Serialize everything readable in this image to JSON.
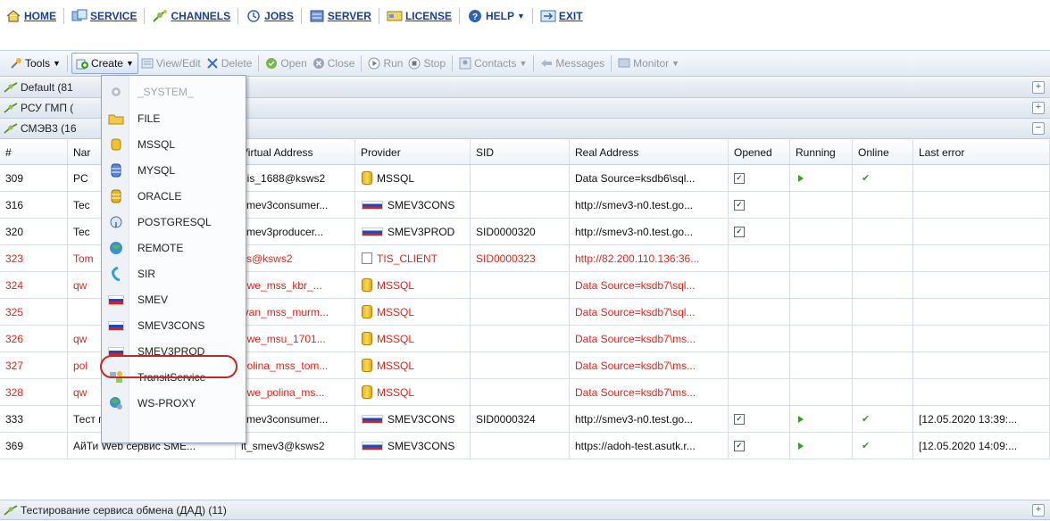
{
  "nav": {
    "home": "HOME",
    "service": "SERVICE",
    "channels": "CHANNELS",
    "jobs": "JOBS",
    "server": "SERVER",
    "license": "LICENSE",
    "help": "HELP",
    "exit": "EXIT"
  },
  "toolbar": {
    "tools": "Tools",
    "create": "Create",
    "view_edit": "View/Edit",
    "delete": "Delete",
    "open": "Open",
    "close": "Close",
    "run": "Run",
    "stop": "Stop",
    "contacts": "Contacts",
    "messages": "Messages",
    "monitor": "Monitor"
  },
  "groups": {
    "default": "Default (81",
    "rsu": "РСУ ГМП (",
    "smev3": "СМЭВ3 (16",
    "test": "Тестирование сервиса обмена (ДАД) (11)"
  },
  "columns": [
    "#",
    "Nar",
    "Virtual Address",
    "Provider",
    "SID",
    "Real Address",
    "Opened",
    "Running",
    "Online",
    "Last error"
  ],
  "rows": [
    {
      "num": "309",
      "name": "PC",
      "vaddr": "gis_1688@ksws2",
      "provider": "MSSQL",
      "picon": "db",
      "sid": "",
      "raddr": "Data Source=ksdb6\\sql...",
      "opened": true,
      "running": true,
      "online": true,
      "error": "",
      "red": false
    },
    {
      "num": "316",
      "name": "Tec",
      "vaddr": "smev3consumer...",
      "provider": "SMEV3CONS",
      "picon": "flag",
      "sid": "",
      "raddr": "http://smev3-n0.test.go...",
      "opened": true,
      "running": false,
      "online": false,
      "error": "",
      "red": false
    },
    {
      "num": "320",
      "name": "Tec",
      "vaddr": "smev3producer...",
      "provider": "SMEV3PROD",
      "picon": "flag",
      "sid": "SID0000320",
      "raddr": "http://smev3-n0.test.go...",
      "opened": true,
      "running": false,
      "online": false,
      "error": "",
      "red": false
    },
    {
      "num": "323",
      "name": "Tom",
      "vaddr": "tis@ksws2",
      "provider": "TIS_CLIENT",
      "picon": "tis",
      "sid": "SID0000323",
      "raddr": "http://82.200.110.136:36...",
      "opened": false,
      "running": false,
      "online": false,
      "error": "",
      "red": true
    },
    {
      "num": "324",
      "name": "qw",
      "vaddr": "qwe_mss_kbr_...",
      "provider": "MSSQL",
      "picon": "db",
      "sid": "",
      "raddr": "Data Source=ksdb7\\sql...",
      "opened": false,
      "running": false,
      "online": false,
      "error": "",
      "red": true
    },
    {
      "num": "325",
      "name": "",
      "vaddr": "ivan_mss_murm...",
      "provider": "MSSQL",
      "picon": "db",
      "sid": "",
      "raddr": "Data Source=ksdb7\\sql...",
      "opened": false,
      "running": false,
      "online": false,
      "error": "",
      "red": true
    },
    {
      "num": "326",
      "name": "qw",
      "vaddr": "qwe_msu_1701...",
      "provider": "MSSQL",
      "picon": "db",
      "sid": "",
      "raddr": "Data Source=ksdb7\\ms...",
      "opened": false,
      "running": false,
      "online": false,
      "error": "",
      "red": true
    },
    {
      "num": "327",
      "name": "pol",
      "vaddr": "polina_mss_tom...",
      "provider": "MSSQL",
      "picon": "db",
      "sid": "",
      "raddr": "Data Source=ksdb7\\ms...",
      "opened": false,
      "running": false,
      "online": false,
      "error": "",
      "red": true
    },
    {
      "num": "328",
      "name": "qw",
      "vaddr": "qwe_polina_ms...",
      "provider": "MSSQL",
      "picon": "db",
      "sid": "",
      "raddr": "Data Source=ksdb7\\ms...",
      "opened": false,
      "running": false,
      "online": false,
      "error": "",
      "red": true
    },
    {
      "num": "333",
      "name": "Тест потребителя СМ...",
      "vaddr": "smev3consumer...",
      "provider": "SMEV3CONS",
      "picon": "flag",
      "sid": "SID0000324",
      "raddr": "http://smev3-n0.test.go...",
      "opened": true,
      "running": true,
      "online": true,
      "error": "[12.05.2020 13:39:...",
      "red": false
    },
    {
      "num": "369",
      "name": "АйТи Web сервис SME...",
      "vaddr": "it_smev3@ksws2",
      "provider": "SMEV3CONS",
      "picon": "flag",
      "sid": "",
      "raddr": "https://adoh-test.asutk.r...",
      "opened": true,
      "running": true,
      "online": true,
      "error": "[12.05.2020 14:09:...",
      "red": false
    }
  ],
  "menu": [
    {
      "label": "_SYSTEM_",
      "icon": "gear-icon",
      "disabled": true
    },
    {
      "label": "FILE",
      "icon": "folder-icon",
      "disabled": false
    },
    {
      "label": "MSSQL",
      "icon": "database-yellow-icon",
      "disabled": false
    },
    {
      "label": "MYSQL",
      "icon": "database-blue-icon",
      "disabled": false
    },
    {
      "label": "ORACLE",
      "icon": "database-gold-icon",
      "disabled": false
    },
    {
      "label": "POSTGRESQL",
      "icon": "elephant-icon",
      "disabled": false
    },
    {
      "label": "REMOTE",
      "icon": "globe-icon",
      "disabled": false
    },
    {
      "label": "SIR",
      "icon": "sir-icon",
      "disabled": false
    },
    {
      "label": "SMEV",
      "icon": "russian-flag-icon",
      "disabled": false
    },
    {
      "label": "SMEV3CONS",
      "icon": "russian-flag-icon",
      "disabled": false
    },
    {
      "label": "SMEV3PROD",
      "icon": "russian-flag-icon",
      "disabled": false
    },
    {
      "label": "TransitService",
      "icon": "transit-icon",
      "disabled": false
    },
    {
      "label": "WS-PROXY",
      "icon": "globe-gear-icon",
      "disabled": false
    }
  ]
}
